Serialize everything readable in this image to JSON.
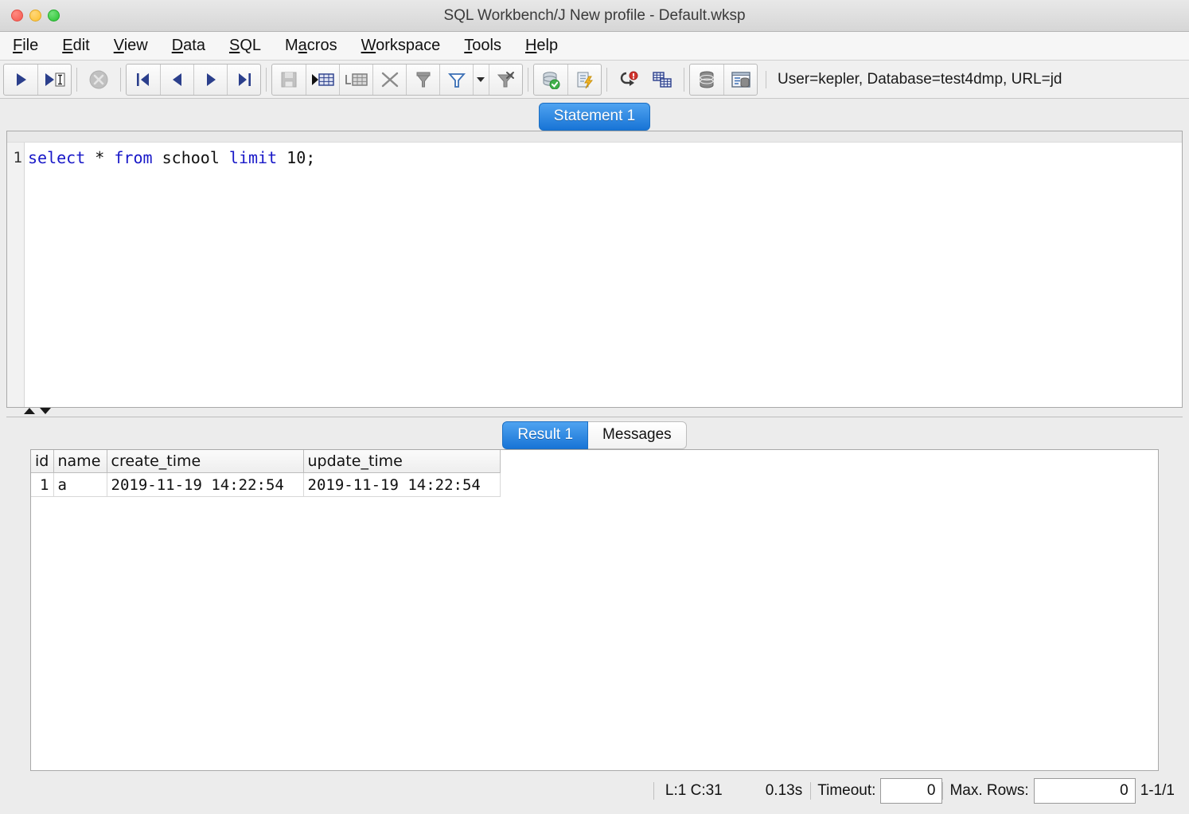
{
  "window": {
    "title": "SQL Workbench/J New profile - Default.wksp",
    "traffic_lights": [
      "close",
      "minimize",
      "zoom"
    ]
  },
  "menubar": {
    "items": [
      {
        "label": "File",
        "mnemonic": "F"
      },
      {
        "label": "Edit",
        "mnemonic": "E"
      },
      {
        "label": "View",
        "mnemonic": "V"
      },
      {
        "label": "Data",
        "mnemonic": "D"
      },
      {
        "label": "SQL",
        "mnemonic": "S"
      },
      {
        "label": "Macros",
        "mnemonic": "a"
      },
      {
        "label": "Workspace",
        "mnemonic": "W"
      },
      {
        "label": "Tools",
        "mnemonic": "T"
      },
      {
        "label": "Help",
        "mnemonic": "H"
      }
    ]
  },
  "toolbar": {
    "buttons": [
      {
        "name": "execute-all-icon",
        "tooltip": "Execute all"
      },
      {
        "name": "execute-current-icon",
        "tooltip": "Execute current statement"
      },
      {
        "name": "stop-icon",
        "tooltip": "Cancel",
        "enabled": false
      },
      {
        "name": "first-row-icon",
        "tooltip": "First row"
      },
      {
        "name": "previous-row-icon",
        "tooltip": "Previous row"
      },
      {
        "name": "next-row-icon",
        "tooltip": "Next row"
      },
      {
        "name": "last-row-icon",
        "tooltip": "Last row"
      },
      {
        "name": "save-changes-icon",
        "tooltip": "Save data changes",
        "enabled": false
      },
      {
        "name": "insert-row-icon",
        "tooltip": "Insert row"
      },
      {
        "name": "copy-row-icon",
        "tooltip": "Duplicate row"
      },
      {
        "name": "delete-row-icon",
        "tooltip": "Delete row"
      },
      {
        "name": "filter-data-icon",
        "tooltip": "Filter data"
      },
      {
        "name": "quick-filter-icon",
        "tooltip": "Quick filter"
      },
      {
        "name": "filter-dropdown-caret-icon",
        "tooltip": "Filter options"
      },
      {
        "name": "reset-filter-icon",
        "tooltip": "Reset filter"
      },
      {
        "name": "commit-icon",
        "tooltip": "Commit"
      },
      {
        "name": "rollback-icon",
        "tooltip": "Rollback"
      },
      {
        "name": "clear-statement-icon",
        "tooltip": "Clear"
      },
      {
        "name": "show-table-data-icon",
        "tooltip": "Show table data"
      },
      {
        "name": "database-icon",
        "tooltip": "Database"
      },
      {
        "name": "db-explorer-icon",
        "tooltip": "Database Explorer"
      }
    ],
    "connection_info": "User=kepler, Database=test4dmp, URL=jd"
  },
  "editor": {
    "tab": {
      "label": "Statement 1",
      "active": true
    },
    "line_numbers": [
      "1"
    ],
    "sql_tokens": [
      {
        "text": "select",
        "type": "keyword"
      },
      {
        "text": " ",
        "type": "plain"
      },
      {
        "text": "*",
        "type": "plain"
      },
      {
        "text": " ",
        "type": "plain"
      },
      {
        "text": "from",
        "type": "keyword"
      },
      {
        "text": " ",
        "type": "plain"
      },
      {
        "text": "school",
        "type": "plain"
      },
      {
        "text": " ",
        "type": "plain"
      },
      {
        "text": "limit",
        "type": "keyword"
      },
      {
        "text": " ",
        "type": "plain"
      },
      {
        "text": "10;",
        "type": "plain"
      }
    ],
    "sql_text": "select * from school limit 10;"
  },
  "splitter": {
    "collapse_up_icon": "triangle-up",
    "collapse_down_icon": "triangle-down"
  },
  "results": {
    "tabs": [
      {
        "label": "Result 1",
        "active": true
      },
      {
        "label": "Messages",
        "active": false
      }
    ],
    "columns": [
      "id",
      "name",
      "create_time",
      "update_time"
    ],
    "rows": [
      [
        "1",
        "a",
        "2019-11-19 14:22:54",
        "2019-11-19 14:22:54"
      ]
    ]
  },
  "statusbar": {
    "cursor_position": "L:1 C:31",
    "exec_time": "0.13s",
    "timeout_label": "Timeout:",
    "timeout_value": "0",
    "max_rows_label": "Max. Rows:",
    "max_rows_value": "0",
    "row_counter": "1-1/1"
  },
  "colors": {
    "accent_blue": "#1874d6",
    "keyword_blue": "#1818c8",
    "toolbar_bg": "#f0f0f0",
    "window_bg": "#ececec"
  }
}
